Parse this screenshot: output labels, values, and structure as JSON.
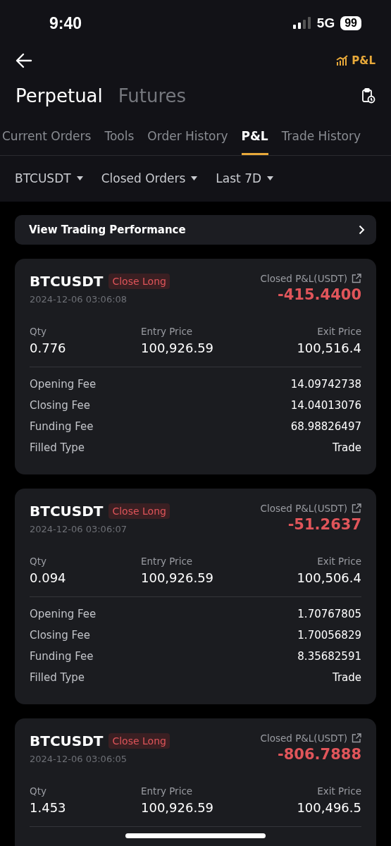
{
  "status_bar": {
    "time": "9:40",
    "network": "5G",
    "battery": "99"
  },
  "header": {
    "pnl_link": "P&L"
  },
  "product_tabs": [
    {
      "label": "Perpetual",
      "selected": true
    },
    {
      "label": "Futures",
      "selected": false
    }
  ],
  "tabs": [
    {
      "label": "Current Orders",
      "selected": false
    },
    {
      "label": "Tools",
      "selected": false
    },
    {
      "label": "Order History",
      "selected": false
    },
    {
      "label": "P&L",
      "selected": true
    },
    {
      "label": "Trade History",
      "selected": false
    }
  ],
  "filters": [
    {
      "label": "BTCUSDT"
    },
    {
      "label": "Closed Orders"
    },
    {
      "label": "Last 7D"
    }
  ],
  "banner": {
    "label": "View Trading Performance"
  },
  "orders": [
    {
      "symbol": "BTCUSDT",
      "side": "Close Long",
      "time": "2024-12-06 03:06:08",
      "pnl_label": "Closed P&L(USDT)",
      "pnl": "-415.4400",
      "qty_label": "Qty",
      "qty": "0.776",
      "entry_label": "Entry Price",
      "entry": "100,926.59",
      "exit_label": "Exit Price",
      "exit": "100,516.4",
      "fees": [
        {
          "label": "Opening Fee",
          "value": "14.09742738"
        },
        {
          "label": "Closing Fee",
          "value": "14.04013076"
        },
        {
          "label": "Funding Fee",
          "value": "68.98826497"
        },
        {
          "label": "Filled Type",
          "value": "Trade"
        }
      ]
    },
    {
      "symbol": "BTCUSDT",
      "side": "Close Long",
      "time": "2024-12-06 03:06:07",
      "pnl_label": "Closed P&L(USDT)",
      "pnl": "-51.2637",
      "qty_label": "Qty",
      "qty": "0.094",
      "entry_label": "Entry Price",
      "entry": "100,926.59",
      "exit_label": "Exit Price",
      "exit": "100,506.4",
      "fees": [
        {
          "label": "Opening Fee",
          "value": "1.70767805"
        },
        {
          "label": "Closing Fee",
          "value": "1.70056829"
        },
        {
          "label": "Funding Fee",
          "value": "8.35682591"
        },
        {
          "label": "Filled Type",
          "value": "Trade"
        }
      ]
    },
    {
      "symbol": "BTCUSDT",
      "side": "Close Long",
      "time": "2024-12-06 03:06:05",
      "pnl_label": "Closed P&L(USDT)",
      "pnl": "-806.7888",
      "qty_label": "Qty",
      "qty": "1.453",
      "entry_label": "Entry Price",
      "entry": "100,926.59",
      "exit_label": "Exit Price",
      "exit": "100,496.5"
    }
  ]
}
